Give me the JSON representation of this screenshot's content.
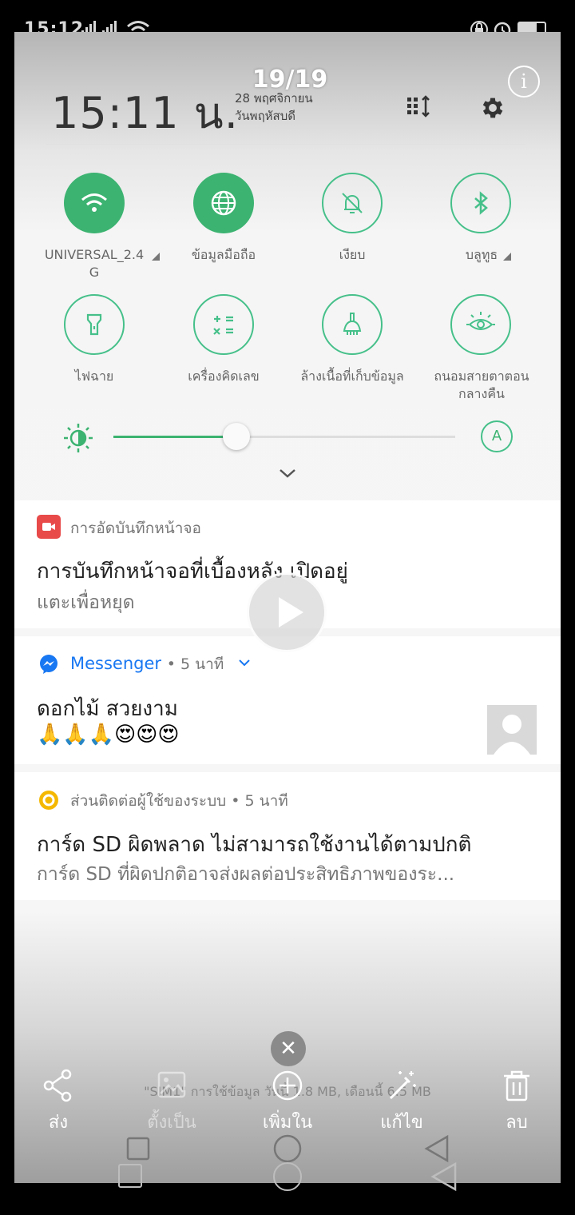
{
  "status_bar": {
    "time": "15:12"
  },
  "photo_viewer": {
    "counter": "19/19",
    "info_icon": "info-icon"
  },
  "shade": {
    "time": "15:11 น.",
    "date_line1": "28 พฤศจิกายน",
    "date_line2": "วันพฤหัสบดี",
    "tiles": [
      {
        "label_line1": "UNIVERSAL_2.4",
        "label_line2": "G",
        "icon": "wifi-icon",
        "active": true
      },
      {
        "label_line1": "ข้อมูลมือถือ",
        "label_line2": "",
        "icon": "globe-icon",
        "active": true
      },
      {
        "label_line1": "เงียบ",
        "label_line2": "",
        "icon": "bell-off-icon",
        "active": false
      },
      {
        "label_line1": "บลูทูธ",
        "label_line2": "",
        "icon": "bluetooth-icon",
        "active": false
      },
      {
        "label_line1": "ไฟฉาย",
        "label_line2": "",
        "icon": "flashlight-icon",
        "active": false
      },
      {
        "label_line1": "เครื่องคิดเลข",
        "label_line2": "",
        "icon": "calculator-icon",
        "active": false
      },
      {
        "label_line1": "ล้างเนื้อที่เก็บข้อมูล",
        "label_line2": "",
        "icon": "clean-icon",
        "active": false
      },
      {
        "label_line1": "ถนอมสายตาตอน",
        "label_line2": "กลางคืน",
        "icon": "eye-icon",
        "active": false
      }
    ],
    "brightness": {
      "level": 0.36,
      "auto_label": "A"
    }
  },
  "notifications": [
    {
      "app": "การอัดบันทึกหน้าจอ",
      "title": "การบันทึกหน้าจอที่เบื้องหลัง เปิดอยู่",
      "subtitle": "แตะเพื่อหยุด"
    },
    {
      "app": "Messenger",
      "time": "• 5 นาที",
      "title": "ดอกไม้ สวยงาม",
      "subtitle": "🙏🙏🙏😍😍😍"
    },
    {
      "app": "ส่วนติดต่อผู้ใช้ของระบบ",
      "time": "• 5 นาที",
      "title": "การ์ด SD ผิดพลาด ไม่สามารถใช้งานได้ตามปกติ",
      "subtitle": "การ์ด SD ที่ผิดปกติอาจส่งผลต่อประสิทธิภาพของระ..."
    }
  ],
  "usage_text": "\"SIM1\" การใช้ข้อมูล วันนี้ 1.8 MB, เดือนนี้ 6.5 MB",
  "actions": {
    "share": "ส่ง",
    "set_as": "ตั้งเป็น",
    "add_to": "เพิ่มใน",
    "edit": "แก้ไข",
    "delete": "ลบ"
  },
  "colors": {
    "accent": "#3cb371",
    "messenger": "#1877f2",
    "recorder": "#e84a4a",
    "system": "#f5b800"
  }
}
